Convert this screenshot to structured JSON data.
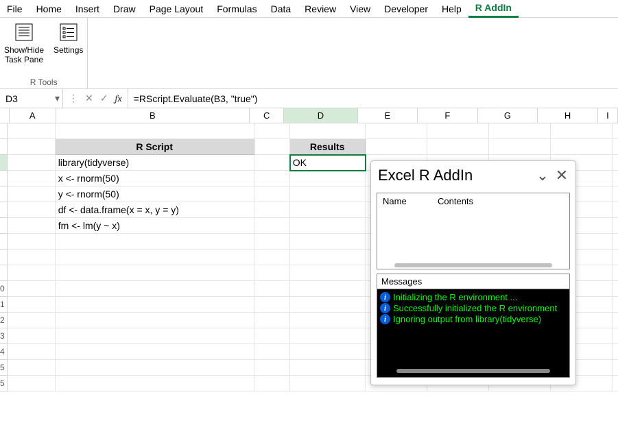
{
  "ribbon": {
    "tabs": [
      "File",
      "Home",
      "Insert",
      "Draw",
      "Page Layout",
      "Formulas",
      "Data",
      "Review",
      "View",
      "Developer",
      "Help",
      "R AddIn"
    ],
    "active_tab": "R AddIn",
    "group_name": "R Tools",
    "show_hide_label": "Show/Hide\nTask Pane",
    "settings_label": "Settings"
  },
  "formula_bar": {
    "namebox": "D3",
    "formula": "=RScript.Evaluate(B3, \"true\")"
  },
  "columns": [
    "A",
    "B",
    "C",
    "D",
    "E",
    "F",
    "G",
    "H",
    "I"
  ],
  "row_labels": [
    "",
    "",
    "",
    "",
    "",
    "",
    "",
    "",
    "",
    "",
    "0",
    "1",
    "2",
    "3",
    "4",
    "5",
    "5"
  ],
  "sheet": {
    "b2": "R Script",
    "b3": "library(tidyverse)",
    "b4": "x <- rnorm(50)",
    "b5": "y <- rnorm(50)",
    "b6": "df <- data.frame(x = x, y = y)",
    "b7": "fm <- lm(y ~ x)",
    "d2": "Results",
    "d3": "OK"
  },
  "task_pane": {
    "title": "Excel R AddIn",
    "env_col1": "Name",
    "env_col2": "Contents",
    "messages_title": "Messages",
    "messages": [
      "Initializing the R environment ...",
      "Successfully initialized the R environment",
      "Ignoring output from library(tidyverse)"
    ]
  }
}
